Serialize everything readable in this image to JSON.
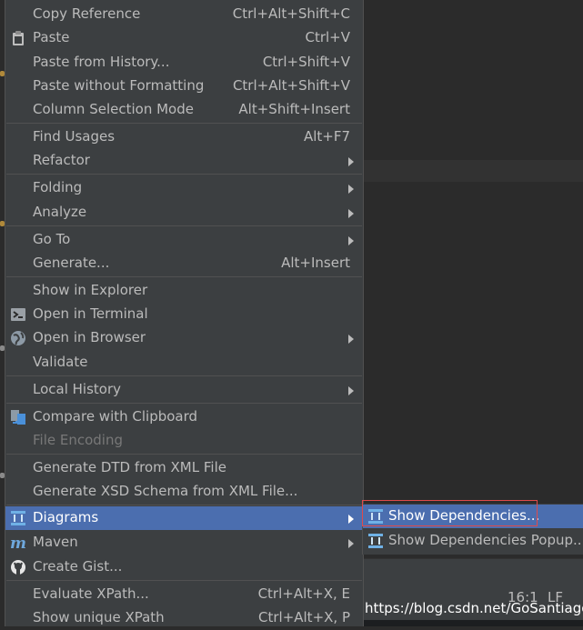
{
  "menu": {
    "items": [
      {
        "label": "Copy Reference",
        "shortcut": "Ctrl+Alt+Shift+C"
      },
      {
        "label": "Paste",
        "shortcut": "Ctrl+V",
        "icon": "clipboard-icon"
      },
      {
        "label": "Paste from History...",
        "shortcut": "Ctrl+Shift+V"
      },
      {
        "label": "Paste without Formatting",
        "shortcut": "Ctrl+Alt+Shift+V"
      },
      {
        "label": "Column Selection Mode",
        "shortcut": "Alt+Shift+Insert"
      },
      {
        "label": "Find Usages",
        "shortcut": "Alt+F7"
      },
      {
        "label": "Refactor",
        "submenu": true
      },
      {
        "label": "Folding",
        "submenu": true
      },
      {
        "label": "Analyze",
        "submenu": true
      },
      {
        "label": "Go To",
        "submenu": true
      },
      {
        "label": "Generate...",
        "shortcut": "Alt+Insert"
      },
      {
        "label": "Show in Explorer"
      },
      {
        "label": "Open in Terminal",
        "icon": "terminal-icon"
      },
      {
        "label": "Open in Browser",
        "submenu": true,
        "icon": "globe-icon"
      },
      {
        "label": "Validate"
      },
      {
        "label": "Local History",
        "submenu": true
      },
      {
        "label": "Compare with Clipboard",
        "icon": "compare-icon"
      },
      {
        "label": "File Encoding",
        "disabled": true
      },
      {
        "label": "Generate DTD from XML File"
      },
      {
        "label": "Generate XSD Schema from XML File..."
      },
      {
        "label": "Diagrams",
        "submenu": true,
        "selected": true,
        "icon": "diagram-icon"
      },
      {
        "label": "Maven",
        "submenu": true,
        "icon": "maven-icon"
      },
      {
        "label": "Create Gist...",
        "icon": "github-icon"
      },
      {
        "label": "Evaluate XPath...",
        "shortcut": "Ctrl+Alt+X, E"
      },
      {
        "label": "Show unique XPath",
        "shortcut": "Ctrl+Alt+X, P"
      }
    ]
  },
  "submenu": {
    "items": [
      {
        "label": "Show Dependencies..."
      },
      {
        "label": "Show Dependencies Popup..."
      }
    ]
  },
  "status": {
    "position": "16:1",
    "line_ending": "LF"
  },
  "watermark": "https://blog.csdn.net/GoSantiago",
  "colors": {
    "menu_bg": "#3c3f41",
    "selection": "#4b6eaf",
    "editor_bg": "#2b2b2b",
    "highlight_box": "#e04a4a"
  }
}
